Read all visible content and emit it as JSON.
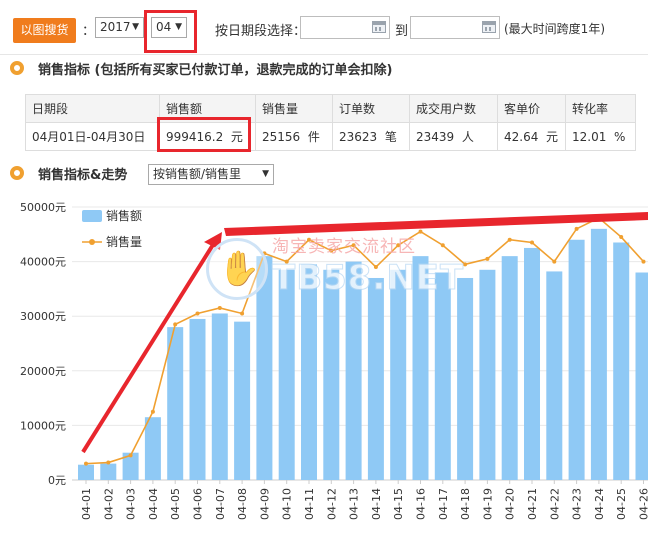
{
  "toolbar": {
    "search_button": "以图搜货",
    "colon": "：",
    "year": "2017",
    "month": "04",
    "date_range_label": "按日期段选择：",
    "start_date": "",
    "end_date": "",
    "to_label": "到",
    "max_span_note": "(最大时间跨度1年)"
  },
  "section1": {
    "title": "销售指标 (包括所有买家已付款订单，退款完成的订单会扣除)"
  },
  "stats_table": {
    "headers": [
      "日期段",
      "销售额",
      "销售量",
      "订单数",
      "成交用户数",
      "客单价",
      "转化率"
    ],
    "row": [
      {
        "value": "04月01日-04月30日",
        "unit": ""
      },
      {
        "value": "999416.2",
        "unit": "元"
      },
      {
        "value": "25156",
        "unit": "件"
      },
      {
        "value": "23623",
        "unit": "笔"
      },
      {
        "value": "23439",
        "unit": "人"
      },
      {
        "value": "42.64",
        "unit": "元"
      },
      {
        "value": "12.01",
        "unit": "%"
      }
    ]
  },
  "section2": {
    "title": "销售指标&走势",
    "metric_select": "按销售额/销售里"
  },
  "watermark": {
    "line1": "淘宝卖家交流社区",
    "line2": "TB58.NET"
  },
  "colors": {
    "bar": "#8fc9f5",
    "line": "#f0a030",
    "accent": "#f07c1d",
    "highlight": "#e8262d"
  },
  "chart_data": {
    "type": "bar",
    "categories": [
      "04-01",
      "04-02",
      "04-03",
      "04-04",
      "04-05",
      "04-06",
      "04-07",
      "04-08",
      "04-09",
      "04-10",
      "04-11",
      "04-12",
      "04-13",
      "04-14",
      "04-15",
      "04-16",
      "04-17",
      "04-18",
      "04-19",
      "04-20",
      "04-21",
      "04-22",
      "04-23",
      "04-24",
      "04-25",
      "04-26"
    ],
    "series": [
      {
        "name": "销售额",
        "type": "bar",
        "values": [
          2800,
          3000,
          5000,
          11500,
          28000,
          29500,
          30500,
          29000,
          41000,
          38500,
          39500,
          38500,
          40000,
          37000,
          38500,
          41000,
          38000,
          37000,
          38500,
          41000,
          42500,
          38200,
          44000,
          46000,
          43500,
          38000
        ]
      },
      {
        "name": "销售量",
        "type": "line",
        "values": [
          3000,
          3200,
          4500,
          12500,
          28500,
          30500,
          31500,
          30500,
          41500,
          40000,
          44000,
          42000,
          43000,
          39000,
          43000,
          45500,
          43000,
          39500,
          40500,
          44000,
          43500,
          40000,
          46000,
          48000,
          44500,
          40000
        ]
      }
    ],
    "yticks": [
      "0元",
      "10000元",
      "20000元",
      "30000元",
      "40000元",
      "50000元"
    ],
    "ylim": [
      0,
      50000
    ],
    "legend_position": "top-left",
    "grid": true
  }
}
